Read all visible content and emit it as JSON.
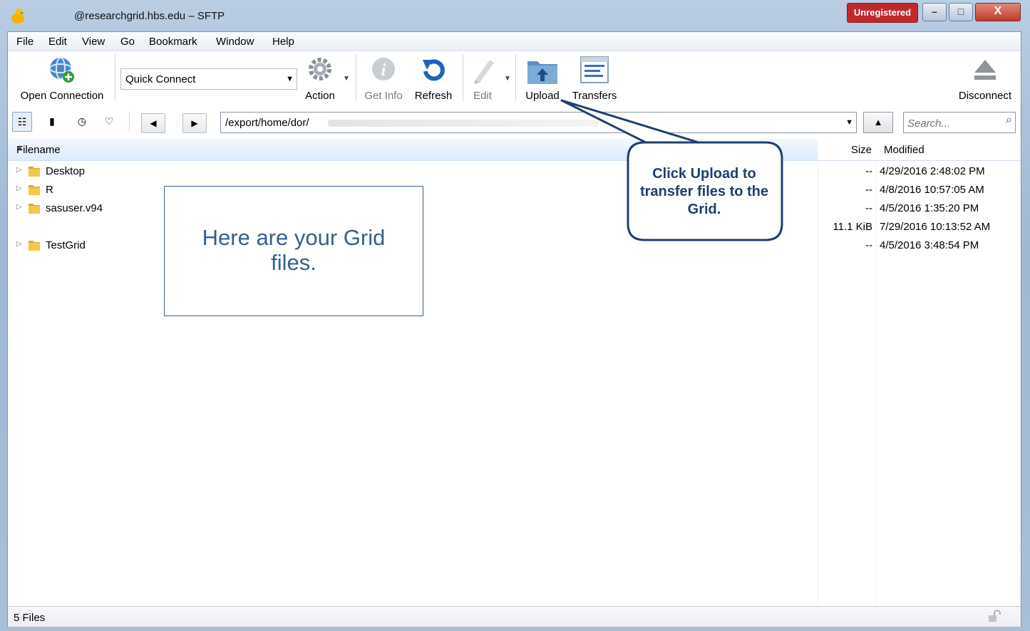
{
  "window": {
    "title": "@researchgrid.hbs.edu – SFTP",
    "badge": "Unregistered",
    "controls": {
      "minimize": "–",
      "maximize": "□",
      "close": "X"
    }
  },
  "menu": [
    "File",
    "Edit",
    "View",
    "Go",
    "Bookmark",
    "Window",
    "Help"
  ],
  "toolbar": {
    "open_connection": "Open Connection",
    "quick_connect": "Quick Connect",
    "action": "Action",
    "get_info": "Get Info",
    "refresh": "Refresh",
    "edit": "Edit",
    "upload": "Upload",
    "transfers": "Transfers",
    "disconnect": "Disconnect"
  },
  "navigation": {
    "back": "◀",
    "forward": "▶",
    "path": "/export/home/dor/",
    "parent": "▲",
    "search_placeholder": "Search..."
  },
  "columns": {
    "filename": "Filename",
    "size": "Size",
    "modified": "Modified"
  },
  "files": [
    {
      "name": "Desktop",
      "size": "--",
      "modified": "4/29/2016 2:48:02 PM",
      "folder": true
    },
    {
      "name": "R",
      "size": "--",
      "modified": "4/8/2016 10:57:05 AM",
      "folder": true
    },
    {
      "name": "sasuser.v94",
      "size": "--",
      "modified": "4/5/2016 1:35:20 PM",
      "folder": true
    },
    {
      "name": "",
      "size": "11.1 KiB",
      "modified": "7/29/2016 10:13:52 AM",
      "folder": false
    },
    {
      "name": "TestGrid",
      "size": "--",
      "modified": "4/5/2016 3:48:54 PM",
      "folder": true
    }
  ],
  "status": {
    "count": "5 Files"
  },
  "annotations": {
    "files_note": "Here are your Grid files.",
    "upload_callout": "Click Upload to transfer files to the Grid."
  },
  "colors": {
    "accent": "#34608f",
    "callout_border": "#1f3f70",
    "badge": "#c1282d"
  }
}
